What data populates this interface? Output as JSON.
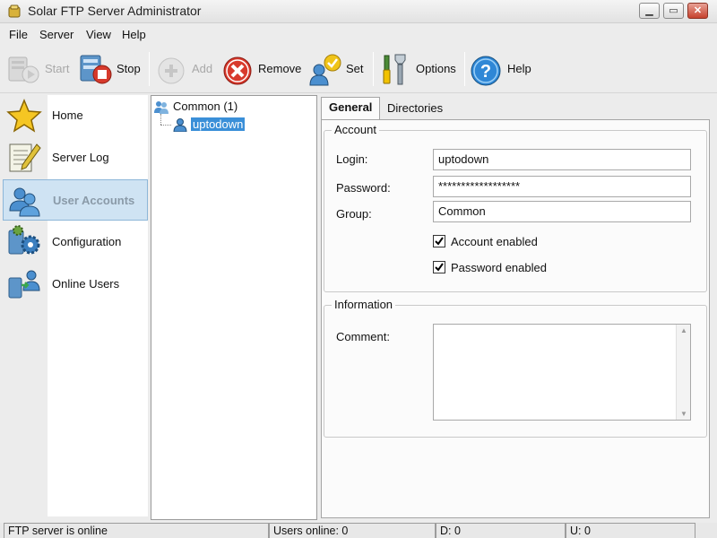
{
  "window": {
    "title": "Solar FTP Server Administrator"
  },
  "menu": [
    "File",
    "Server",
    "View",
    "Help"
  ],
  "toolbar": {
    "start": "Start",
    "stop": "Stop",
    "add": "Add",
    "remove": "Remove",
    "set": "Set",
    "options": "Options",
    "help": "Help"
  },
  "nav": {
    "items": [
      {
        "label": "Home",
        "icon": "star-icon"
      },
      {
        "label": "Server Log",
        "icon": "notepad-icon"
      },
      {
        "label": "User Accounts",
        "icon": "users-icon",
        "selected": true
      },
      {
        "label": "Configuration",
        "icon": "gears-icon"
      },
      {
        "label": "Online Users",
        "icon": "network-icon"
      }
    ]
  },
  "tree": {
    "group": "Common (1)",
    "user": "uptodown"
  },
  "tabs": [
    "General",
    "Directories"
  ],
  "account": {
    "legend": "Account",
    "login_label": "Login:",
    "login_value": "uptodown",
    "password_label": "Password:",
    "password_value": "******************",
    "group_label": "Group:",
    "group_value": "Common",
    "account_enabled": "Account enabled",
    "password_enabled": "Password enabled"
  },
  "information": {
    "legend": "Information",
    "comment_label": "Comment:"
  },
  "status": {
    "server": "FTP server is online",
    "users_online": "Users online: 0",
    "d": "D: 0",
    "u": "U: 0"
  },
  "colors": {
    "selection": "#3a8fd8",
    "nav_selected": "#cfe3f3",
    "close_button": "#c6412d"
  }
}
